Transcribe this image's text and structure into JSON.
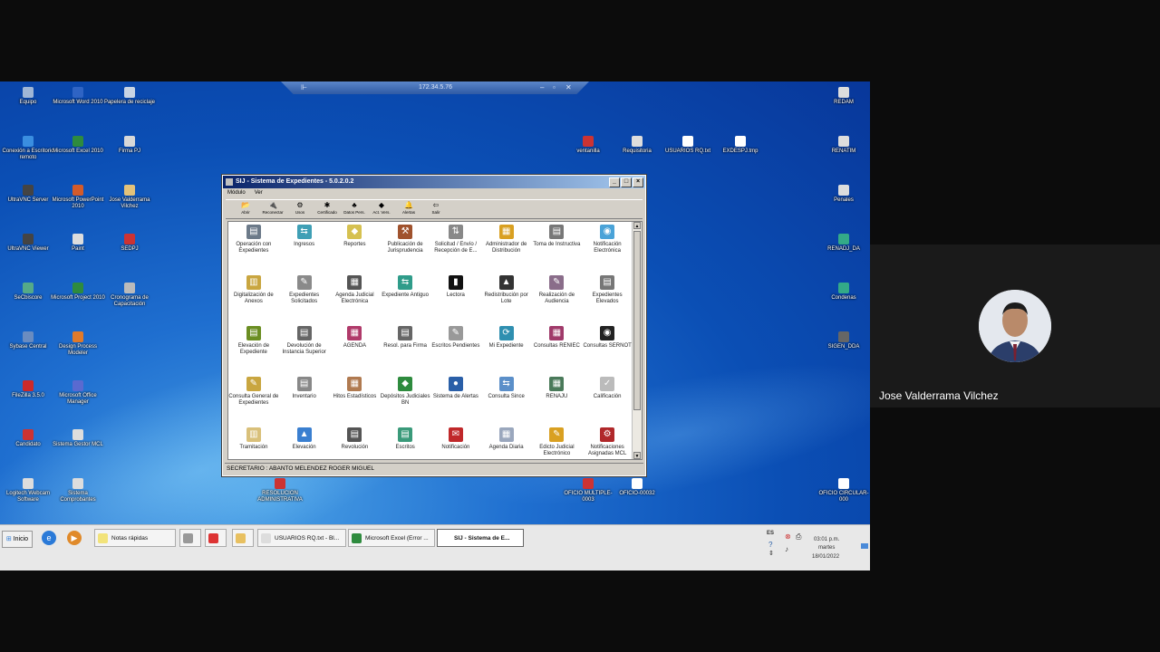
{
  "rdp_bar": {
    "address": "172.34.5.76",
    "pin_icon": "pin-icon",
    "minimize": "–",
    "restore": "▫",
    "close": "✕"
  },
  "desktop_icons_left": [
    {
      "label": "Equipo",
      "color": "#9fb6d6"
    },
    {
      "label": "Microsoft Word 2010",
      "color": "#2f64c4"
    },
    {
      "label": "Papelera de reciclaje",
      "color": "#c8d4e4"
    },
    {
      "label": "Conexión a Escritorio remoto",
      "color": "#3a8ee0"
    },
    {
      "label": "Microsoft Excel 2010",
      "color": "#2e8b3e"
    },
    {
      "label": "Firma PJ",
      "color": "#d8d8d8"
    },
    {
      "label": "UltraVNC Server",
      "color": "#444"
    },
    {
      "label": "Microsoft PowerPoint 2010",
      "color": "#d35b2a"
    },
    {
      "label": "Jose Valderrama Vilchez",
      "color": "#e3c27a"
    },
    {
      "label": "UltraVNC Viewer",
      "color": "#444"
    },
    {
      "label": "Paint",
      "color": "#ddd"
    },
    {
      "label": "SEDPJ",
      "color": "#cc3333"
    },
    {
      "label": "SeCbiscore",
      "color": "#5a8"
    },
    {
      "label": "Microsoft Project 2010",
      "color": "#2e8b3e"
    },
    {
      "label": "Cronograma de Capacitación",
      "color": "#bbb"
    },
    {
      "label": "Sybase Central",
      "color": "#6a8cc0"
    },
    {
      "label": "Design Process Modeler",
      "color": "#e07a2a"
    },
    {
      "label": "FileZilla 3.5.0",
      "color": "#cc2a2a"
    },
    {
      "label": "Microsoft Office Manager",
      "color": "#5a6ad0"
    },
    {
      "label": "Candidato",
      "color": "#c33"
    },
    {
      "label": "Sistema Gestor MCL",
      "color": "#ddd"
    },
    {
      "label": "Logitech Webcam Software",
      "color": "#ddd"
    },
    {
      "label": "Sistema Comprobantes",
      "color": "#ddd"
    }
  ],
  "desktop_icons_right": [
    {
      "label": "REDAM",
      "color": "#ddd"
    },
    {
      "label": "ventanilla",
      "color": "#c33"
    },
    {
      "label": "Requisitoria",
      "color": "#ddd"
    },
    {
      "label": "USUARIOS RQ.txt",
      "color": "#fff"
    },
    {
      "label": "EXDESPJ.tmp",
      "color": "#fff"
    },
    {
      "label": "RENATIM",
      "color": "#ddd"
    },
    {
      "label": "Penales",
      "color": "#ddd"
    },
    {
      "label": "RENADJ_DA",
      "color": "#3a8"
    },
    {
      "label": "Condenas",
      "color": "#3a8"
    },
    {
      "label": "SIGEN_DDA",
      "color": "#666"
    },
    {
      "label": "RESOLUCION ADMINISTRATIVA",
      "color": "#c33"
    },
    {
      "label": "OFICIO MULTIPLE-0003",
      "color": "#c33"
    },
    {
      "label": "OFICIO-00032",
      "color": "#fff"
    },
    {
      "label": "OFICIO CIRCULAR-000",
      "color": "#fff"
    }
  ],
  "window": {
    "title": "SIJ - Sistema de Expedientes - 5.0.2.0.2",
    "menu": [
      "Módulo",
      "Ver"
    ],
    "toolbar": [
      {
        "label": "Abrir",
        "icon": "open-icon",
        "glyph": "📂"
      },
      {
        "label": "Reconectar",
        "icon": "reconnect-icon",
        "glyph": "🔌"
      },
      {
        "label": "Usos",
        "icon": "usage-icon",
        "glyph": "⚙"
      },
      {
        "label": "Certificado",
        "icon": "certificate-icon",
        "glyph": "✱"
      },
      {
        "label": "Datos Pers.",
        "icon": "personal-data-icon",
        "glyph": "♣"
      },
      {
        "label": "Act. Vers.",
        "icon": "update-icon",
        "glyph": "◆"
      },
      {
        "label": "Alertas",
        "icon": "alerts-icon",
        "glyph": "🔔"
      },
      {
        "label": "Salir",
        "icon": "exit-icon",
        "glyph": "⇦"
      }
    ],
    "modules": [
      {
        "label": "Operación con Expedientes",
        "color": "#6c7a89",
        "glyph": "▤"
      },
      {
        "label": "Ingresos",
        "color": "#3f9fb5",
        "glyph": "⇆"
      },
      {
        "label": "Reportes",
        "color": "#d6c150",
        "glyph": "◆"
      },
      {
        "label": "Publicación de Jurisprudencia",
        "color": "#a0522d",
        "glyph": "⚒"
      },
      {
        "label": "Solicitud / Envío / Recepción de E...",
        "color": "#888",
        "glyph": "⇅"
      },
      {
        "label": "Administrador de Distribución",
        "color": "#d9a021",
        "glyph": "▦"
      },
      {
        "label": "Toma de Instructiva",
        "color": "#777",
        "glyph": "▤"
      },
      {
        "label": "Notificación Electrónica",
        "color": "#4aa3d8",
        "glyph": "◉"
      },
      {
        "label": "Digitalización de Anexos",
        "color": "#c9a640",
        "glyph": "▥"
      },
      {
        "label": "Expedientes Solicitados",
        "color": "#8a8a8a",
        "glyph": "✎"
      },
      {
        "label": "Agenda Judicial Electrónica",
        "color": "#555",
        "glyph": "▦"
      },
      {
        "label": "Expediente Antiguo",
        "color": "#2f9c8a",
        "glyph": "⇆"
      },
      {
        "label": "Lectora",
        "color": "#111",
        "glyph": "▮"
      },
      {
        "label": "Redistribución por Lote",
        "color": "#333",
        "glyph": "▲"
      },
      {
        "label": "Realización de Audiencia",
        "color": "#8a6d8a",
        "glyph": "✎"
      },
      {
        "label": "Expedientes Elevados",
        "color": "#777",
        "glyph": "▤"
      },
      {
        "label": "Elevación de Expediente",
        "color": "#6b8e23",
        "glyph": "▤"
      },
      {
        "label": "Devolución de Instancia Superior",
        "color": "#666",
        "glyph": "▤"
      },
      {
        "label": "AGENDA",
        "color": "#b03a6a",
        "glyph": "▦"
      },
      {
        "label": "Resol. para Firma",
        "color": "#666",
        "glyph": "▤"
      },
      {
        "label": "Escritos Pendientes",
        "color": "#999",
        "glyph": "✎"
      },
      {
        "label": "Mi Expediente",
        "color": "#2f8fb0",
        "glyph": "⟳"
      },
      {
        "label": "Consultas RENIEC",
        "color": "#a03a6a",
        "glyph": "▦"
      },
      {
        "label": "Consultas SERNOT",
        "color": "#222",
        "glyph": "◉"
      },
      {
        "label": "Consulta General de Expedientes",
        "color": "#c9a640",
        "glyph": "✎"
      },
      {
        "label": "Inventario",
        "color": "#888",
        "glyph": "▤"
      },
      {
        "label": "Hitos Estadísticos",
        "color": "#b07a50",
        "glyph": "▦"
      },
      {
        "label": "Depósitos Judiciales BN",
        "color": "#2e8b3e",
        "glyph": "◆"
      },
      {
        "label": "Sistema de Alertas",
        "color": "#2a5fa8",
        "glyph": "●"
      },
      {
        "label": "Consulta Since",
        "color": "#5b8fc9",
        "glyph": "⇆"
      },
      {
        "label": "RENAJU",
        "color": "#4a7a5a",
        "glyph": "▦"
      },
      {
        "label": "Calificación",
        "color": "#bbb",
        "glyph": "✓"
      },
      {
        "label": "Tramitación",
        "color": "#d9c07a",
        "glyph": "▥"
      },
      {
        "label": "Elevación",
        "color": "#3a7fd0",
        "glyph": "▲"
      },
      {
        "label": "Revolución",
        "color": "#555",
        "glyph": "▤"
      },
      {
        "label": "Escritos",
        "color": "#3a9a7a",
        "glyph": "▤"
      },
      {
        "label": "Notificación",
        "color": "#c0282a",
        "glyph": "✉"
      },
      {
        "label": "Agenda Diaria",
        "color": "#9aa7bd",
        "glyph": "▦"
      },
      {
        "label": "Edicto Judicial Electrónico",
        "color": "#d9a021",
        "glyph": "✎"
      },
      {
        "label": "Notificaciones Asignadas MCL",
        "color": "#b0282a",
        "glyph": "⚙"
      }
    ],
    "status": "SECRETARIO : ABANTO MELENDEZ ROGER MIGUEL"
  },
  "taskbar": {
    "start_label": "Inicio",
    "quick_launch": [
      {
        "icon": "ie-icon",
        "color": "#2a7ad8",
        "glyph": "e"
      },
      {
        "icon": "media-player-icon",
        "color": "#e08a2a",
        "glyph": "▶"
      }
    ],
    "tasks": [
      {
        "label": "Notas rápidas",
        "color": "#f2e37a"
      },
      {
        "label": "",
        "color": "#999"
      },
      {
        "label": "",
        "color": "#d33"
      },
      {
        "label": "",
        "color": "#e8c060"
      },
      {
        "label": "USUARIOS RQ.txt - Bl...",
        "color": "#ddd"
      },
      {
        "label": "Microsoft Excel (Error ...",
        "color": "#2e8b3e"
      },
      {
        "label": "SIJ - Sistema de E...",
        "color": "#fff"
      }
    ],
    "lang": "ES",
    "time": "03:01 p.m.",
    "day": "martes",
    "date": "18/01/2022"
  },
  "participant": {
    "name": "Jose Valderrama Vilchez"
  }
}
